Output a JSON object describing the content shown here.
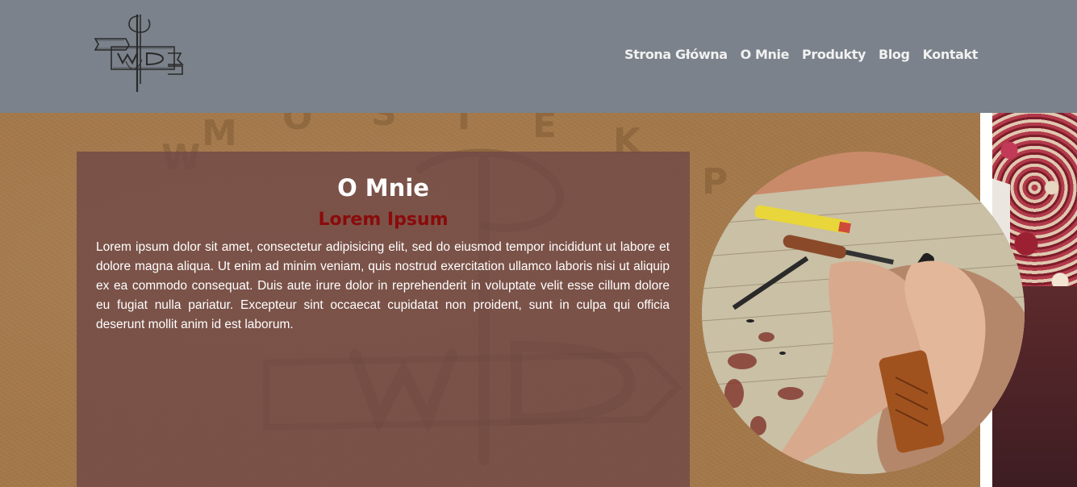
{
  "header": {
    "logo": {
      "icon": "pwd-needle-logo-icon"
    },
    "nav": [
      {
        "label": "Strona Główna"
      },
      {
        "label": "O Mnie"
      },
      {
        "label": "Produkty"
      },
      {
        "label": "Blog"
      },
      {
        "label": "Kontakt"
      }
    ]
  },
  "about": {
    "title": "O Mnie",
    "subtitle": "Lorem Ipsum",
    "body": "Lorem ipsum dolor sit amet, consectetur adipisicing elit, sed do eiusmod tempor incididunt ut labore et dolore magna aliqua. Ut enim ad minim veniam, quis nostrud exercitation ullamco laboris nisi ut aliquip ex ea commodo consequat. Duis aute irure dolor in reprehenderit in voluptate velit esse cillum dolore eu fugiat nulla pariatur. Excepteur sint occaecat cupidatat non proident, sunt in culpa qui officia deserunt mollit anim id est laborum."
  },
  "images": {
    "circle_photo": "hands-stitching-leather-photo",
    "side_photo": "embroidered-fabric-photo"
  },
  "colors": {
    "header_bg": "#7b828b",
    "panel_bg": "#6e4646",
    "subtitle": "#8b0a0a",
    "leather": "#a57a4c"
  }
}
